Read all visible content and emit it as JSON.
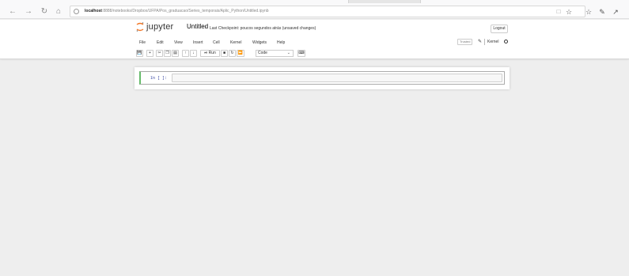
{
  "browser": {
    "url_host": "localhost",
    "url_rest": ":8888/notebooks/Dropbox/UFPA/Pos_graduacao/Series_temporais/Aplic_Python/Untitled.ipynb",
    "icons": [
      "back-icon",
      "forward-icon",
      "refresh-icon",
      "home-icon",
      "reading-view-icon",
      "favorite-star-icon",
      "favorites-icon",
      "notes-icon",
      "share-icon"
    ]
  },
  "jupyter": {
    "logo_text": "jupyter",
    "notebook_name": "Untitled",
    "checkpoint": "Last Checkpoint: poucos segundos atrás  (unsaved changes)",
    "logout": "Logout",
    "menu": [
      "File",
      "Edit",
      "View",
      "Insert",
      "Cell",
      "Kernel",
      "Widgets",
      "Help"
    ],
    "trusted": "Trusted",
    "kernel": "Kernel",
    "toolbar": {
      "run_label": "⏯ Run",
      "cell_type": "Code"
    },
    "cell": {
      "prompt": "In [ ]:",
      "source": ""
    },
    "colors": {
      "logo_orange": "#f37726",
      "cell_edit_green": "#66bb6a",
      "prompt_blue": "#303f9f"
    }
  }
}
